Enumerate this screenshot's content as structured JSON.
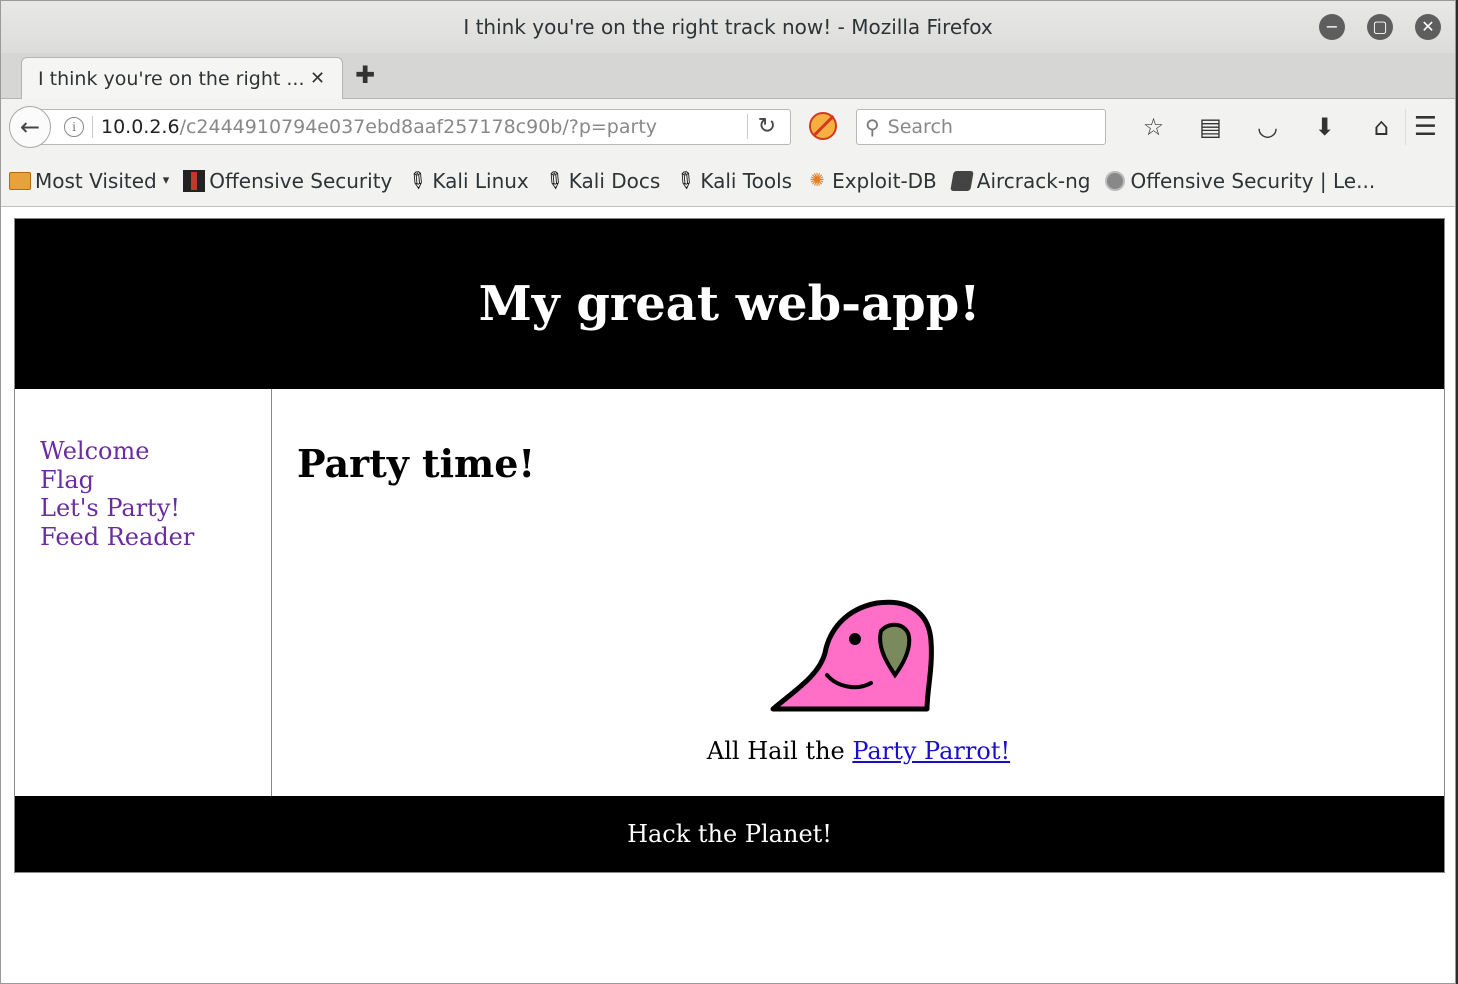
{
  "window": {
    "title": "I think you're on the right track now! - Mozilla Firefox",
    "controls": {
      "minimize": "−",
      "maximize": "▢",
      "close": "✕"
    }
  },
  "tabs": [
    {
      "label": "I think you're on the right ...",
      "close": "✕",
      "active": true
    }
  ],
  "newtab_label": "✚",
  "navbar": {
    "back": "←",
    "info": "i",
    "url_host": "10.0.2.6",
    "url_path": "/c2444910794e037ebd8aaf257178c90b/?p=party",
    "reload": "↻",
    "search_icon": "⚲",
    "search_placeholder": "Search",
    "tools": [
      {
        "name": "bookmark-star-icon",
        "glyph": "☆"
      },
      {
        "name": "reading-list-icon",
        "glyph": "▤"
      },
      {
        "name": "pocket-icon",
        "glyph": "◡"
      },
      {
        "name": "download-icon",
        "glyph": "⬇"
      },
      {
        "name": "home-icon",
        "glyph": "⌂"
      }
    ],
    "menu": "☰"
  },
  "bookmarks": [
    {
      "name": "most-visited",
      "label": "Most Visited",
      "icon": "folder-icon",
      "dropdown": "▾"
    },
    {
      "name": "offensive-security",
      "label": "Offensive Security",
      "icon": "offsec-icon"
    },
    {
      "name": "kali-linux",
      "label": "Kali Linux",
      "icon": "kali-dragon-icon"
    },
    {
      "name": "kali-docs",
      "label": "Kali Docs",
      "icon": "kali-dragon-icon"
    },
    {
      "name": "kali-tools",
      "label": "Kali Tools",
      "icon": "kali-dragon-icon"
    },
    {
      "name": "exploit-db",
      "label": "Exploit-DB",
      "icon": "exploit-db-icon"
    },
    {
      "name": "aircrack-ng",
      "label": "Aircrack-ng",
      "icon": "aircrack-icon"
    },
    {
      "name": "offensive-security-le",
      "label": "Offensive Security | Le...",
      "icon": "globe-icon"
    }
  ],
  "page": {
    "site_title": "My great web-app!",
    "nav": [
      "Welcome",
      "Flag",
      "Let's Party!",
      "Feed Reader"
    ],
    "heading": "Party time!",
    "caption_prefix": "All Hail the ",
    "caption_link": "Party Parrot!",
    "footer": "Hack the Planet!"
  },
  "colors": {
    "header_bg": "#000000",
    "nav_link": "#6b2ca0",
    "link": "#1a0dcc",
    "parrot_body": "#ff6ec7",
    "parrot_beak": "#7a8a5c"
  }
}
